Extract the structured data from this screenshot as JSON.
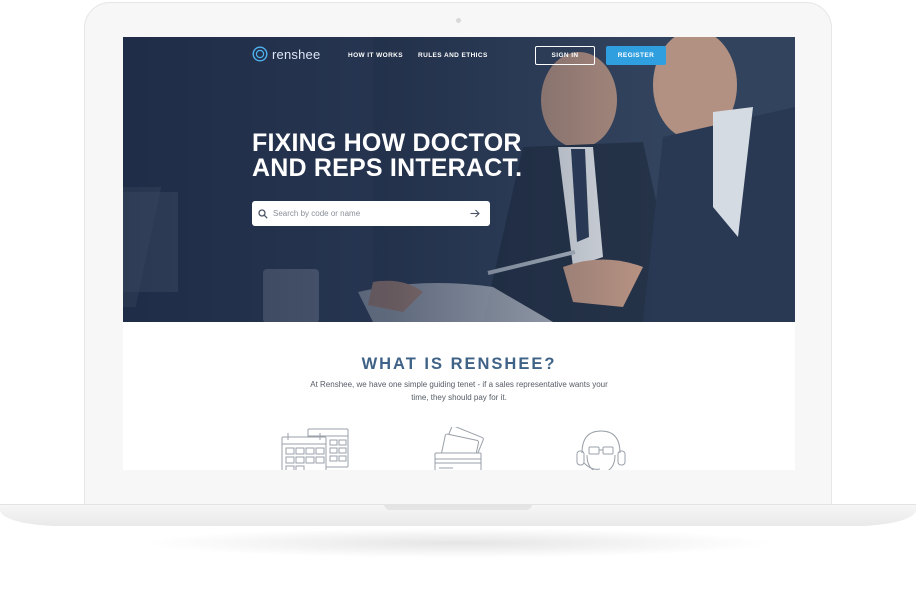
{
  "nav": {
    "logo_text": "renshee",
    "links": [
      "HOW IT WORKS",
      "RULES AND ETHICS"
    ],
    "signin_label": "SIGN IN",
    "register_label": "REGISTER"
  },
  "hero": {
    "title_line1": "FIXING HOW DOCTOR",
    "title_line2": "AND REPS INTERACT.",
    "search_placeholder": "Search by code or name"
  },
  "about": {
    "title": "WHAT IS RENSHEE?",
    "text": "At Renshee, we have one simple guiding tenet - if a sales representative wants your time, they should pay for it."
  },
  "features": {
    "icons": [
      "calendar-icon",
      "credit-cards-icon",
      "headset-icon"
    ]
  },
  "colors": {
    "accent": "#2f9fe0",
    "heading": "#3f6287",
    "hero_dark": "#2b3a55"
  }
}
